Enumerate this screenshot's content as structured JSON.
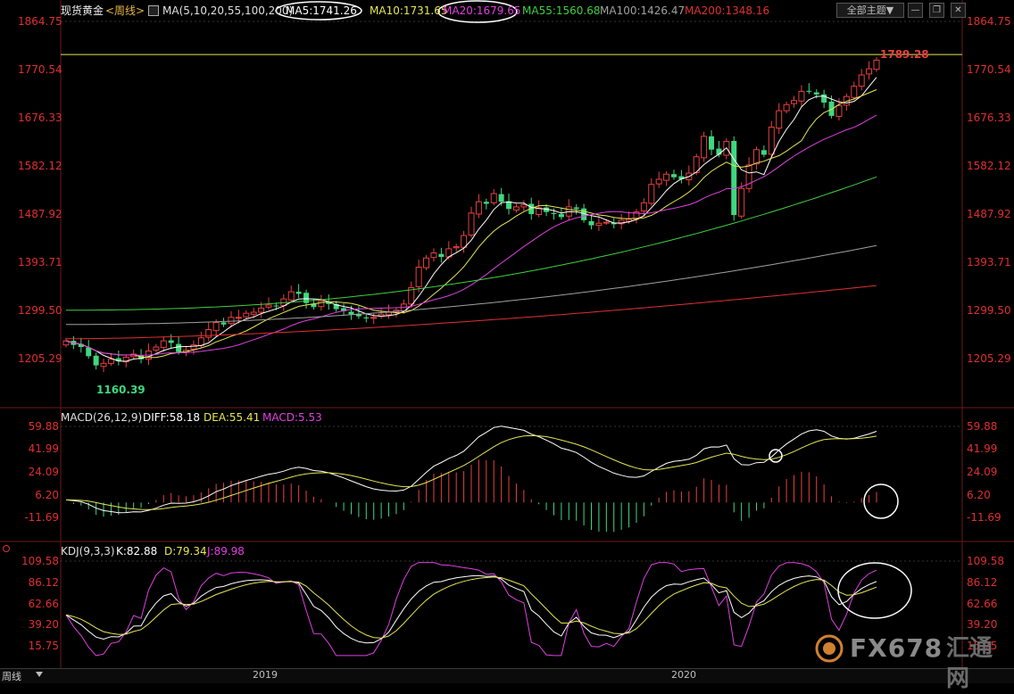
{
  "main_header": {
    "symbol": "现货黄金",
    "period": "<周线>",
    "ma_params": "MA(5,10,20,55,100,200)",
    "ma5": "MA5:1741.26",
    "ma10": "MA10:1731.65",
    "ma20": "MA20:1679.65",
    "ma55": "MA55:1560.68",
    "ma100": "MA100:1426.47",
    "ma200": "MA200:1348.16"
  },
  "theme_button": "全部主题▼",
  "macd_header": {
    "params": "MACD(26,12,9)",
    "diff": "DIFF:58.18",
    "dea": "DEA:55.41",
    "macd": "MACD:5.53"
  },
  "kdj_header": {
    "params": "KDJ(9,3,3)",
    "k": "K:82.88",
    "d": "D:79.34",
    "j": "J:89.98"
  },
  "price_ticks": [
    "1864.75",
    "1770.54",
    "1676.33",
    "1582.12",
    "1487.92",
    "1393.71",
    "1299.50",
    "1205.29"
  ],
  "macd_ticks": [
    "59.88",
    "41.99",
    "24.09",
    "6.20",
    "-11.69"
  ],
  "kdj_ticks": [
    "109.58",
    "86.12",
    "62.66",
    "39.20",
    "15.75"
  ],
  "annotations": {
    "high": "1789.28",
    "low": "1160.39"
  },
  "bottom": {
    "period_button": "周线",
    "year_2019": "2019",
    "year_2020": "2020"
  },
  "watermark": {
    "brand": "FX678",
    "sub": "汇通网"
  },
  "colors": {
    "up": "#e8403f",
    "down": "#3fd87e",
    "ma5": "#ffffff",
    "ma10": "#e6e655",
    "ma20": "#e040e0",
    "ma55": "#40d040",
    "ma100": "#a0a0a0",
    "ma200": "#e03030",
    "macd_diff": "#ffffff",
    "macd_dea": "#e6e655",
    "kdj_j": "#e040e0"
  },
  "chart_data": [
    {
      "type": "candlestick",
      "title": "现货黄金<周线>",
      "ylim": [
        1160.39,
        1864.75
      ],
      "high_marker": 1789.28,
      "low_marker": 1160.39,
      "x_ticks": [
        "2019",
        "2020"
      ],
      "close": [
        1240,
        1232,
        1228,
        1210,
        1192,
        1196,
        1204,
        1200,
        1208,
        1214,
        1204,
        1220,
        1228,
        1240,
        1236,
        1218,
        1222,
        1232,
        1246,
        1262,
        1276,
        1272,
        1286,
        1286,
        1294,
        1296,
        1304,
        1310,
        1308,
        1322,
        1336,
        1332,
        1314,
        1306,
        1318,
        1312,
        1302,
        1298,
        1292,
        1288,
        1284,
        1286,
        1292,
        1296,
        1300,
        1312,
        1344,
        1384,
        1402,
        1412,
        1404,
        1420,
        1424,
        1446,
        1490,
        1512,
        1508,
        1528,
        1512,
        1498,
        1502,
        1506,
        1488,
        1500,
        1492,
        1488,
        1482,
        1502,
        1498,
        1476,
        1466,
        1470,
        1472,
        1468,
        1476,
        1478,
        1492,
        1510,
        1546,
        1556,
        1566,
        1560,
        1556,
        1568,
        1600,
        1640,
        1614,
        1604,
        1630,
        1486,
        1538,
        1584,
        1614,
        1604,
        1658,
        1690,
        1702,
        1710,
        1728,
        1728,
        1722,
        1706,
        1680,
        1700,
        1718,
        1738,
        1760,
        1772,
        1789
      ],
      "ma5_end": 1741.26,
      "ma10_end": 1731.65,
      "ma20_end": 1679.65,
      "ma55_end": 1560.68,
      "ma100_end": 1426.47,
      "ma200_end": 1348.16
    },
    {
      "type": "macd",
      "title": "MACD(26,12,9)",
      "ylim": [
        -11.69,
        59.88
      ],
      "diff_last": 58.18,
      "dea_last": 55.41,
      "macd_last": 5.53
    },
    {
      "type": "kdj",
      "title": "KDJ(9,3,3)",
      "ylim": [
        15.75,
        109.58
      ],
      "k_last": 82.88,
      "d_last": 79.34,
      "j_last": 89.98
    }
  ]
}
